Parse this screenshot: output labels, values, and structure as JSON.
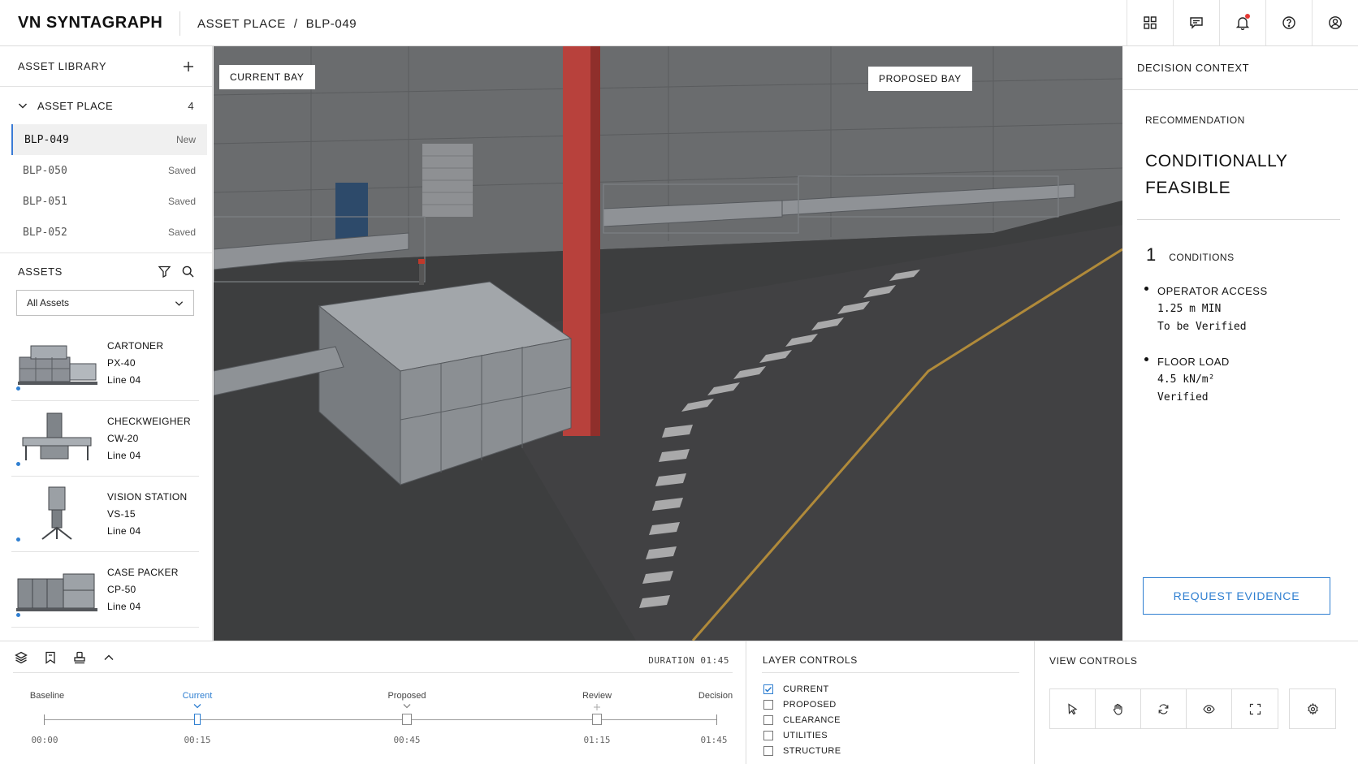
{
  "app": {
    "brand": "VN SYNTAGRAPH",
    "breadcrumb": [
      "ASSET PLACE",
      "/",
      "BLP-049"
    ]
  },
  "top_icons": [
    "grid-icon",
    "chat-icon",
    "bell-icon",
    "help-icon",
    "user-icon"
  ],
  "library": {
    "title": "ASSET LIBRARY",
    "group": {
      "label": "ASSET PLACE",
      "count": "4"
    },
    "items": [
      {
        "id": "BLP-049",
        "state": "New",
        "active": true
      },
      {
        "id": "BLP-050",
        "state": "Saved"
      },
      {
        "id": "BLP-051",
        "state": "Saved"
      },
      {
        "id": "BLP-052",
        "state": "Saved"
      }
    ]
  },
  "assets": {
    "title": "ASSETS",
    "filter_value": "All Assets",
    "items": [
      {
        "name": "CARTONER",
        "model": "PX-40",
        "line": "Line 04"
      },
      {
        "name": "CHECKWEIGHER",
        "model": "CW-20",
        "line": "Line 04"
      },
      {
        "name": "VISION STATION",
        "model": "VS-15",
        "line": "Line 04"
      },
      {
        "name": "CASE PACKER",
        "model": "CP-50",
        "line": "Line 04"
      }
    ]
  },
  "viewport": {
    "tag_current": "CURRENT BAY",
    "tag_proposed": "PROPOSED BAY"
  },
  "decision": {
    "title": "DECISION CONTEXT",
    "recommendation_label": "RECOMMENDATION",
    "recommendation_value": "CONDITIONALLY FEASIBLE",
    "conditions_count": "1",
    "conditions_label": "CONDITIONS",
    "conditions": [
      {
        "title": "OPERATOR ACCESS",
        "value": "1.25 m MIN",
        "status": "To be Verified"
      },
      {
        "title": "FLOOR LOAD",
        "value": "4.5 kN/m²",
        "status": "Verified"
      }
    ],
    "button": "REQUEST EVIDENCE"
  },
  "timeline": {
    "duration": "DURATION 01:45",
    "stops": [
      {
        "label": "Baseline",
        "time": "00:00"
      },
      {
        "label": "Current",
        "time": "00:15"
      },
      {
        "label": "Proposed",
        "time": "00:45"
      },
      {
        "label": "Review",
        "time": "01:15"
      },
      {
        "label": "Decision",
        "time": "01:45"
      }
    ],
    "current_index": 1
  },
  "layers": {
    "title": "LAYER CONTROLS",
    "items": [
      {
        "label": "CURRENT",
        "checked": true
      },
      {
        "label": "PROPOSED",
        "checked": false
      },
      {
        "label": "CLEARANCE",
        "checked": false
      },
      {
        "label": "UTILITIES",
        "checked": false
      },
      {
        "label": "STRUCTURE",
        "checked": false
      }
    ]
  },
  "view_controls": {
    "title": "VIEW CONTROLS",
    "tools": [
      "pointer-icon",
      "hand-icon",
      "rotate-icon",
      "eye-icon",
      "fullscreen-icon",
      "settings-icon"
    ]
  },
  "colors": {
    "accent": "#2f7fd1",
    "column": "#b8413c",
    "floor_line": "#b08a3a"
  }
}
